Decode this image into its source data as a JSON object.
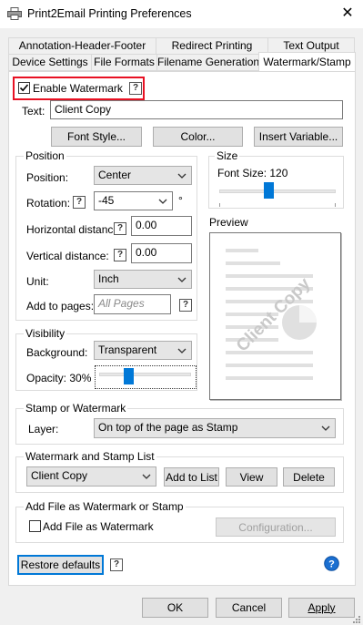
{
  "window": {
    "title": "Print2Email Printing Preferences",
    "close_glyph": "✕"
  },
  "tabs": {
    "row1": [
      "Annotation-Header-Footer",
      "Redirect Printing",
      "Text Output"
    ],
    "row2": [
      "Device Settings",
      "File Formats",
      "Filename Generation",
      "Watermark/Stamp"
    ],
    "active": "Watermark/Stamp"
  },
  "enable_watermark": {
    "label": "Enable Watermark",
    "checked": true,
    "help": "?"
  },
  "text": {
    "label": "Text:",
    "value": "Client Copy"
  },
  "buttons": {
    "font_style": "Font Style...",
    "color": "Color...",
    "insert_variable": "Insert Variable..."
  },
  "position": {
    "title": "Position",
    "position_label": "Position:",
    "position_value": "Center",
    "rotation_label": "Rotation:",
    "rotation_value": "-45",
    "rotation_unit": "°",
    "hdist_label": "Horizontal distance:",
    "hdist_value": "0.00",
    "vdist_label": "Vertical distance:",
    "vdist_value": "0.00",
    "unit_label": "Unit:",
    "unit_value": "Inch",
    "add_to_pages_label": "Add to pages:",
    "add_to_pages_placeholder": "All Pages",
    "help": "?"
  },
  "size": {
    "title": "Size",
    "font_size_label": "Font Size: 120",
    "slider_value": 0.42
  },
  "preview": {
    "title": "Preview",
    "watermark_text": "Client Copy"
  },
  "visibility": {
    "title": "Visibility",
    "background_label": "Background:",
    "background_value": "Transparent",
    "opacity_label": "Opacity: 30%",
    "opacity_value": 0.3
  },
  "stamp": {
    "title": "Stamp or Watermark",
    "layer_label": "Layer:",
    "layer_value": "On top of the page as Stamp"
  },
  "list": {
    "title": "Watermark and Stamp List",
    "selected": "Client Copy",
    "add_button": "Add to List",
    "view_button": "View",
    "delete_button": "Delete"
  },
  "add_file": {
    "title": "Add File as Watermark or Stamp",
    "checkbox_label": "Add File as Watermark",
    "configuration_button": "Configuration..."
  },
  "restore_defaults": "Restore defaults",
  "footer": {
    "ok": "OK",
    "cancel": "Cancel",
    "apply": "Apply"
  },
  "colors": {
    "accent": "#0078d7",
    "highlight_border": "#e81123",
    "help_blue": "#1a6fd1"
  }
}
